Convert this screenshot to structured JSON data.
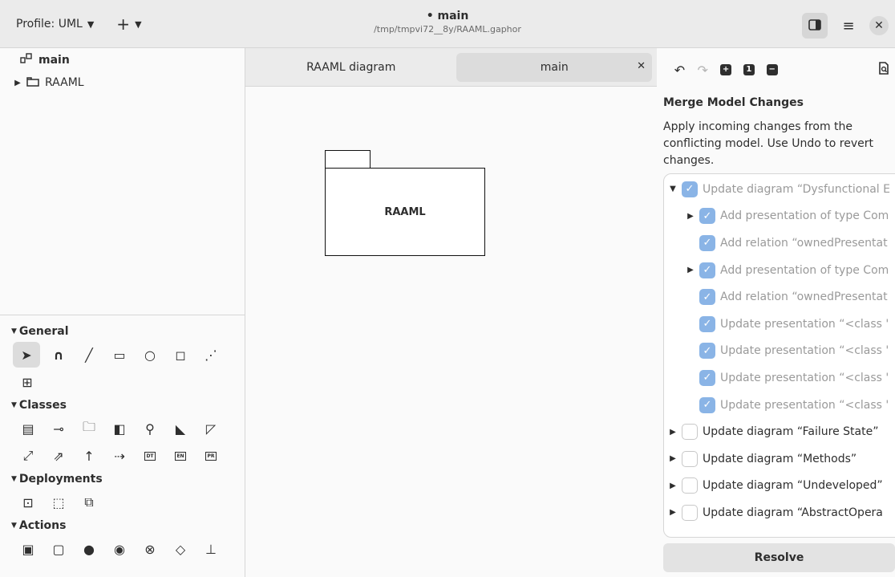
{
  "header": {
    "profile_label": "Profile: UML",
    "add_icon": "plus-icon",
    "title": "• main",
    "subtitle": "/tmp/tmpvi72__8y/RAAML.gaphor",
    "icons": [
      "sidebar-toggle-icon",
      "hamburger-menu-icon",
      "close-icon"
    ]
  },
  "tree": {
    "items": [
      {
        "label": "main",
        "icon": "diagram-icon"
      },
      {
        "label": "RAAML",
        "icon": "package-icon"
      }
    ]
  },
  "toolbox": {
    "sections": [
      {
        "label": "General"
      },
      {
        "label": "Classes"
      },
      {
        "label": "Deployments"
      },
      {
        "label": "Actions"
      }
    ],
    "badges": {
      "dt": "DT",
      "en": "EN",
      "pr": "PR"
    }
  },
  "tabs": [
    {
      "label": "RAAML diagram"
    },
    {
      "label": "main"
    }
  ],
  "canvas": {
    "package_label": "RAAML"
  },
  "merge": {
    "title": "Merge Model Changes",
    "description": "Apply incoming changes from the conflicting model. Use Undo to revert changes.",
    "changes": [
      {
        "label": "Update diagram “Dysfunctional E",
        "checked": true
      },
      {
        "label": "Add presentation of type Com",
        "checked": true
      },
      {
        "label": "Add relation “ownedPresentat",
        "checked": true
      },
      {
        "label": "Add presentation of type Com",
        "checked": true
      },
      {
        "label": "Add relation “ownedPresentat",
        "checked": true
      },
      {
        "label": "Update presentation “<class '",
        "checked": true
      },
      {
        "label": "Update presentation “<class '",
        "checked": true
      },
      {
        "label": "Update presentation “<class '",
        "checked": true
      },
      {
        "label": "Update presentation “<class '",
        "checked": true
      },
      {
        "label": "Update diagram “Failure State”",
        "checked": false
      },
      {
        "label": "Update diagram “Methods”",
        "checked": false
      },
      {
        "label": "Update diagram “Undeveloped”",
        "checked": false
      },
      {
        "label": "Update diagram “AbstractOpera",
        "checked": false
      }
    ],
    "resolve_label": "Resolve"
  },
  "colors": {
    "accent": "#8ab4e6",
    "headerbar": "#ebebeb"
  }
}
